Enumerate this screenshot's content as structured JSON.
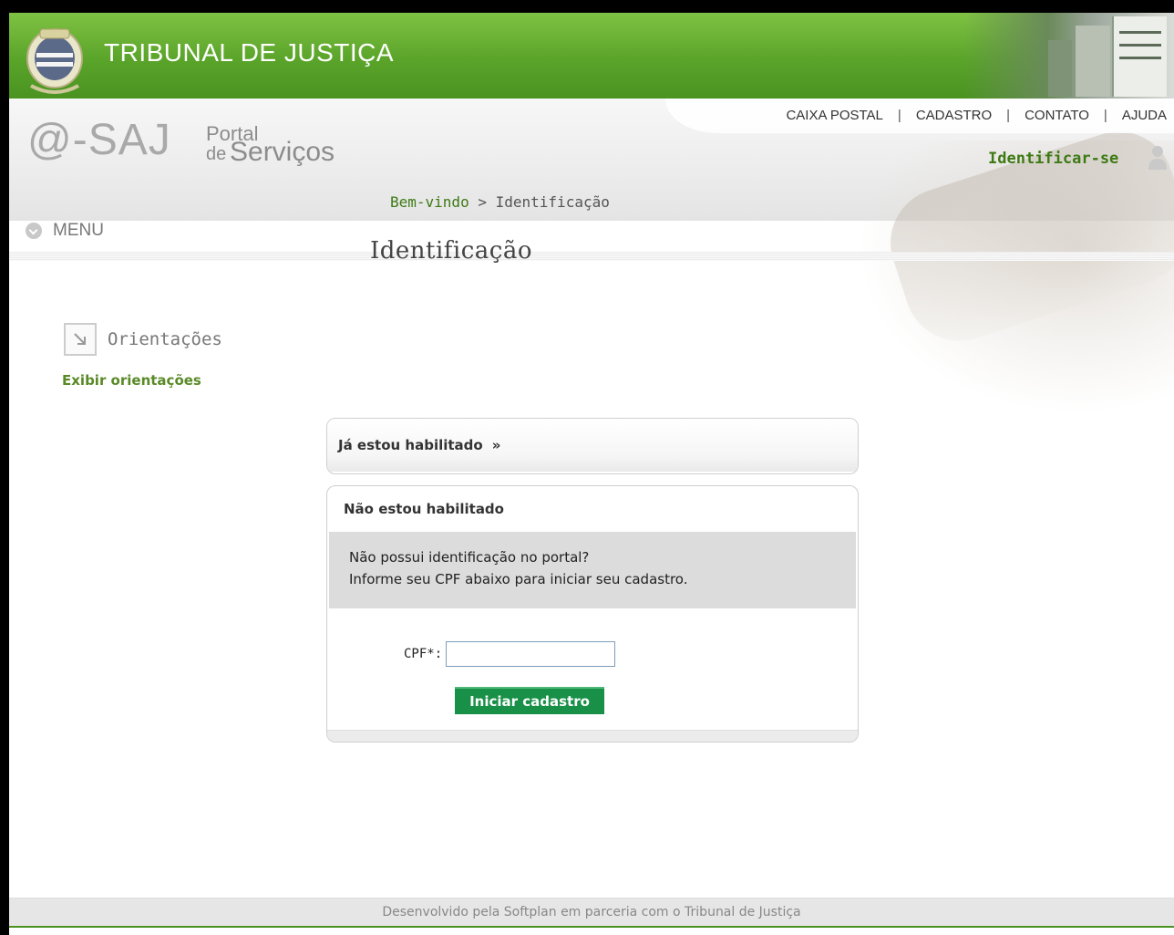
{
  "header": {
    "court_title": "TRIBUNAL DE JUSTIÇA",
    "logo_main": "@-SAJ",
    "logo_portal": "Portal",
    "logo_de": "de",
    "logo_servicos": "Serviços"
  },
  "topnav": {
    "items": [
      "CAIXA POSTAL",
      "CADASTRO",
      "CONTATO",
      "AJUDA"
    ],
    "separator": "|"
  },
  "identify_link": "Identificar-se",
  "breadcrumb": {
    "link": "Bem-vindo",
    "sep": ">",
    "current": "Identificação"
  },
  "menu_label": "MENU",
  "page_title": "Identificação",
  "sidebar": {
    "heading": "Orientações",
    "link": "Exibir orientações"
  },
  "panel_habilitado": {
    "title": "Já estou habilitado",
    "arrow": "»"
  },
  "panel_nao_habilitado": {
    "title": "Não estou habilitado",
    "line1": "Não possui identificação no portal?",
    "line2": "Informe seu CPF abaixo para iniciar seu cadastro.",
    "cpf_label": "CPF*:",
    "cpf_value": "",
    "button": "Iniciar cadastro"
  },
  "footer": "Desenvolvido pela Softplan em parceria com o Tribunal de Justiça",
  "colors": {
    "brand_green": "#5aa42a",
    "link_green": "#3d7a14",
    "button_green": "#189048"
  }
}
